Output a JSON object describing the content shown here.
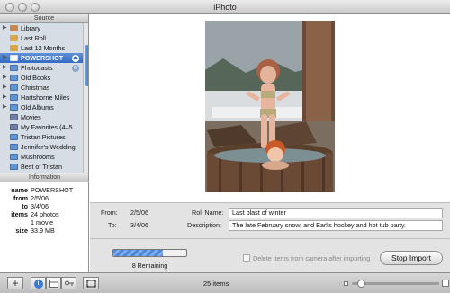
{
  "window": {
    "title": "iPhoto"
  },
  "sidebar": {
    "heading": "Source",
    "sources": [
      {
        "label": "Library",
        "icon": "library-icon",
        "disclosure": "▶"
      },
      {
        "label": "Last Roll",
        "icon": "last-roll-icon",
        "disclosure": ""
      },
      {
        "label": "Last 12 Months",
        "icon": "calendar-icon",
        "disclosure": ""
      },
      {
        "label": "POWERSHOT",
        "icon": "camera-icon",
        "disclosure": "▶",
        "selected": true,
        "badge": "⏏"
      },
      {
        "label": "Photocasts",
        "icon": "photocast-icon",
        "disclosure": "▶",
        "badge": "⊝"
      },
      {
        "label": "Old Books",
        "icon": "album-icon",
        "disclosure": "▶"
      },
      {
        "label": "Christmas",
        "icon": "album-icon",
        "disclosure": "▶"
      },
      {
        "label": "Hartshorne Miles",
        "icon": "album-icon",
        "disclosure": "▶"
      },
      {
        "label": "Old Albums",
        "icon": "album-icon",
        "disclosure": "▶"
      },
      {
        "label": "Movies",
        "icon": "smart-album-icon",
        "disclosure": ""
      },
      {
        "label": "My Favorites (4–5 ...",
        "icon": "smart-album-icon",
        "disclosure": ""
      },
      {
        "label": "Tristan Pictures",
        "icon": "album-icon",
        "disclosure": ""
      },
      {
        "label": "Jennifer's Wedding",
        "icon": "album-icon",
        "disclosure": ""
      },
      {
        "label": "Mushrooms",
        "icon": "album-icon",
        "disclosure": ""
      },
      {
        "label": "Best of Tristan",
        "icon": "album-icon",
        "disclosure": ""
      }
    ]
  },
  "info": {
    "heading": "Information",
    "rows": [
      {
        "key": "name",
        "value": "POWERSHOT"
      },
      {
        "key": "from",
        "value": "2/5/06"
      },
      {
        "key": "to",
        "value": "3/4/06"
      },
      {
        "key": "items",
        "value": "24 photos"
      },
      {
        "key": "",
        "value": "1 movie"
      },
      {
        "key": "size",
        "value": "33.9 MB"
      }
    ]
  },
  "import_details": {
    "from_label": "From:",
    "from_value": "2/5/06",
    "to_label": "To:",
    "to_value": "3/4/06",
    "roll_name_label": "Roll Name:",
    "roll_name_value": "Last blast of winter",
    "description_label": "Description:",
    "description_value": "The late February snow, and Earl's hockey and hot tub party."
  },
  "import_progress": {
    "fraction": 0.68,
    "remaining_text": "8 Remaining",
    "delete_checkbox_label": "Delete items from camera after importing",
    "delete_checkbox_checked": false,
    "stop_button_label": "Stop Import"
  },
  "toolbar": {
    "add_label": "+",
    "info_label": "i",
    "item_count": "25 items",
    "thumbnail_size": 0.1
  },
  "colors": {
    "selection_blue": "#356bc4",
    "sidebar_bg": "#d6dde5",
    "progress_blue": "#4f86d6"
  }
}
